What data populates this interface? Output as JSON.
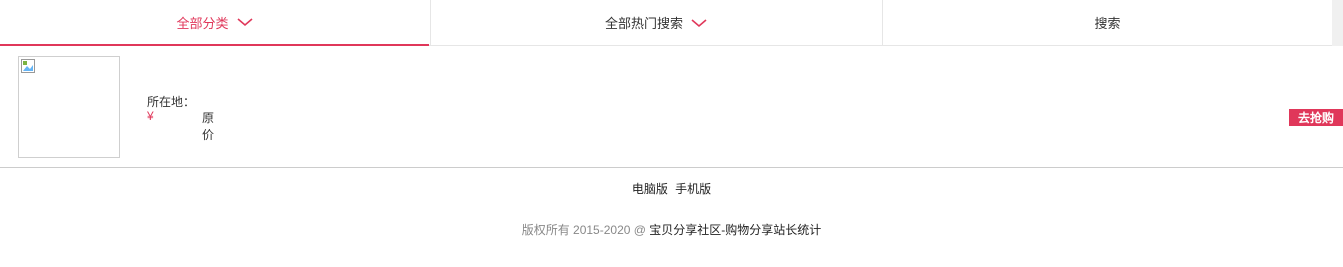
{
  "nav": {
    "tabs": [
      {
        "label": "全部分类"
      },
      {
        "label": "全部热门搜索"
      },
      {
        "label": "搜索"
      }
    ],
    "accent": "#e0375a"
  },
  "item": {
    "location_label": "所在地：",
    "currency": "¥",
    "original_price_label": "原价",
    "buy_label": "去抢购"
  },
  "footer": {
    "desktop_link": "电脑版",
    "mobile_link": "手机版",
    "copyright_prefix": "版权所有 2015-2020 @ ",
    "brand_link": "宝贝分享社区-购物分享站长统计"
  }
}
